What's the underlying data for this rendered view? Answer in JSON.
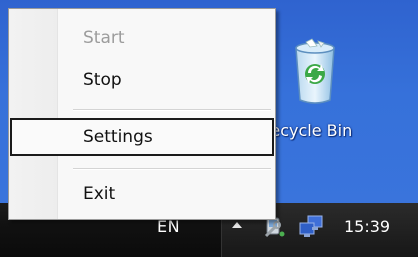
{
  "desktop": {
    "recycle_bin_label": "Recycle Bin"
  },
  "context_menu": {
    "items": [
      {
        "label": "Start",
        "state": "disabled"
      },
      {
        "label": "Stop",
        "state": "enabled"
      },
      {
        "label": "Settings",
        "state": "selected"
      },
      {
        "label": "Exit",
        "state": "enabled"
      }
    ]
  },
  "taskbar": {
    "language": "EN",
    "clock": "15:39",
    "tray_icons": [
      "show-hidden-icons-arrow",
      "network-wrench-icon",
      "network-computers-icon"
    ]
  },
  "colors": {
    "desktop_blue": "#3671da",
    "taskbar": "#111111",
    "menu_bg": "#f8f8f8"
  }
}
